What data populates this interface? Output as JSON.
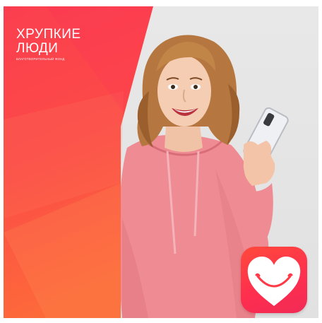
{
  "brand": {
    "name_line1": "ХРУПКИЕ",
    "name_line2": "ЛЮДИ",
    "subtitle": "БЛАГОТВОРИТЕЛЬНЫЙ ФОНД"
  },
  "images": {
    "photo": "smiling-woman-holding-phone",
    "app_icon": "heart-smile-icon"
  },
  "colors": {
    "panel_top": "#fb3e4f",
    "panel_bottom": "#fd6a3a",
    "hoodie": "#ef8b93",
    "icon_red": "#ff3a48"
  }
}
